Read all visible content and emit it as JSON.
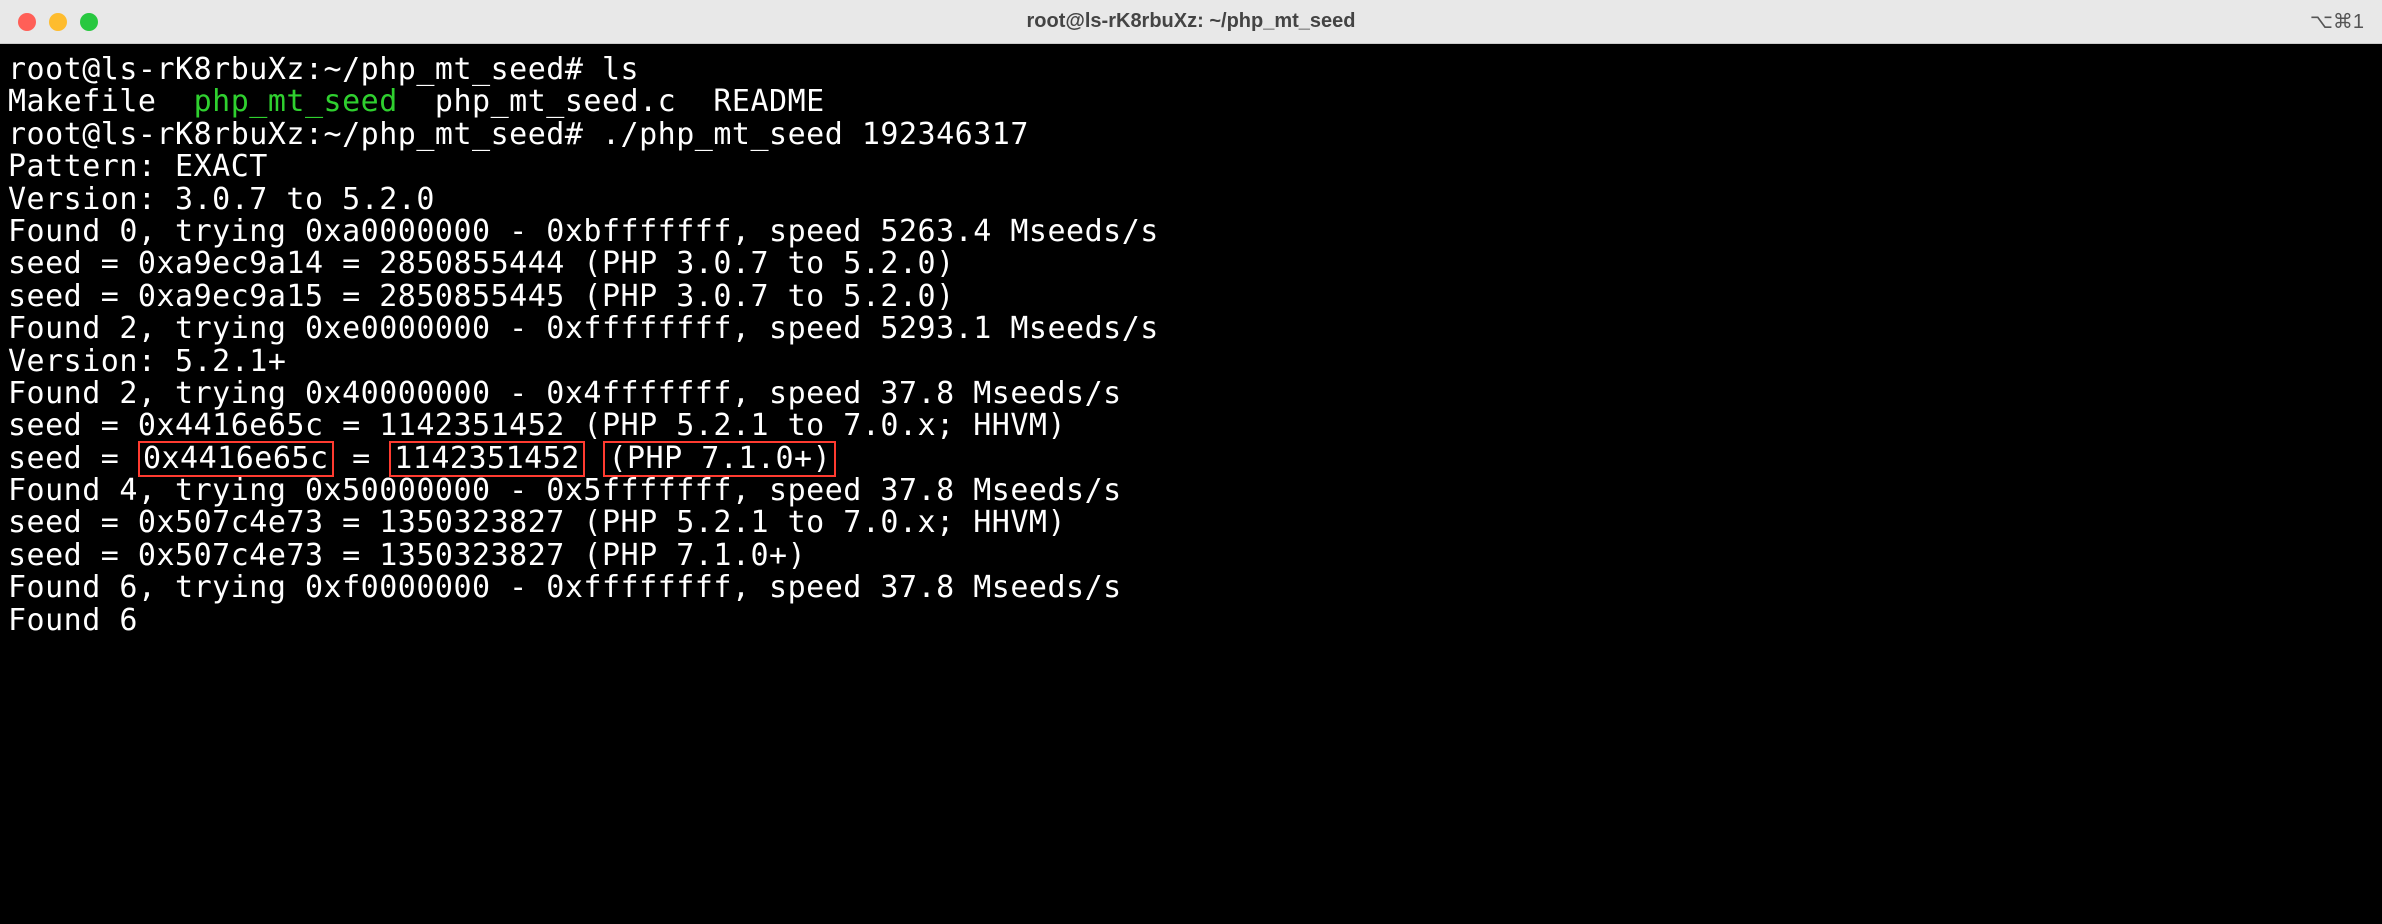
{
  "window": {
    "title": "root@ls-rK8rbuXz: ~/php_mt_seed",
    "shortcut": "⌥⌘1"
  },
  "terminal": {
    "prompt1": "root@ls-rK8rbuXz:~/php_mt_seed# ",
    "cmd1": "ls",
    "ls_out_1": "Makefile  ",
    "ls_out_exec": "php_mt_seed",
    "ls_out_2": "  php_mt_seed.c  README",
    "prompt2": "root@ls-rK8rbuXz:~/php_mt_seed# ",
    "cmd2": "./php_mt_seed 192346317",
    "line_pattern": "Pattern: EXACT",
    "line_ver1": "Version: 3.0.7 to 5.2.0",
    "line_found0": "Found 0, trying 0xa0000000 - 0xbfffffff, speed 5263.4 Mseeds/s",
    "line_seed1": "seed = 0xa9ec9a14 = 2850855444 (PHP 3.0.7 to 5.2.0)",
    "line_seed2": "seed = 0xa9ec9a15 = 2850855445 (PHP 3.0.7 to 5.2.0)",
    "line_found2a": "Found 2, trying 0xe0000000 - 0xffffffff, speed 5293.1 Mseeds/s",
    "line_ver2": "Version: 5.2.1+",
    "line_found2b": "Found 2, trying 0x40000000 - 0x4fffffff, speed 37.8 Mseeds/s",
    "line_seed3": "seed = 0x4416e65c = 1142351452 (PHP 5.2.1 to 7.0.x; HHVM)",
    "hl_prefix": "seed = ",
    "hl_hex": "0x4416e65c",
    "hl_eq": " = ",
    "hl_dec": "1142351452",
    "hl_sp": " ",
    "hl_ver": "(PHP 7.1.0+)",
    "line_found4": "Found 4, trying 0x50000000 - 0x5fffffff, speed 37.8 Mseeds/s",
    "line_seed5": "seed = 0x507c4e73 = 1350323827 (PHP 5.2.1 to 7.0.x; HHVM)",
    "line_seed6": "seed = 0x507c4e73 = 1350323827 (PHP 7.1.0+)",
    "line_found6a": "Found 6, trying 0xf0000000 - 0xffffffff, speed 37.8 Mseeds/s",
    "line_found6b": "Found 6"
  }
}
